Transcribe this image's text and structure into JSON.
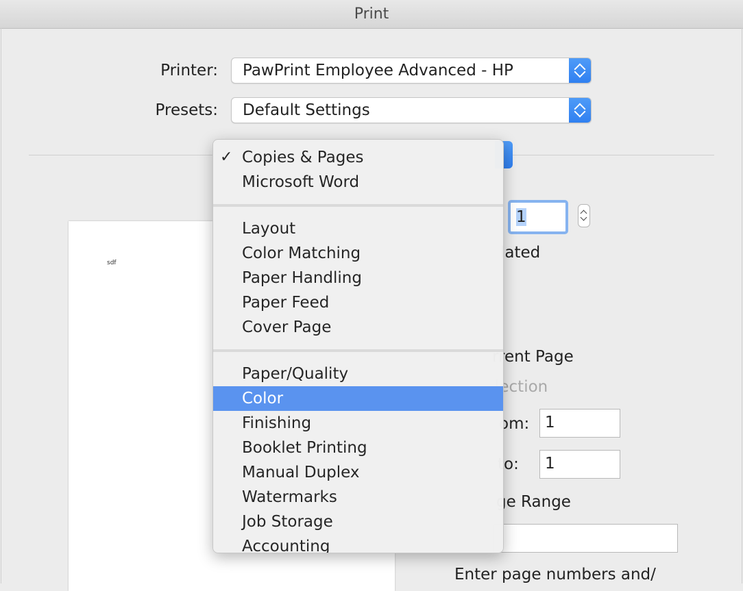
{
  "window": {
    "title": "Print"
  },
  "printer": {
    "label": "Printer:",
    "value": "PawPrint Employee Advanced - HP"
  },
  "presets": {
    "label": "Presets:",
    "value": "Default Settings"
  },
  "preview": {
    "page_text": "sdf"
  },
  "copies": {
    "value": "1",
    "collated_text": "lated"
  },
  "pages": {
    "current_page_text": "rrent Page",
    "selection_text": "lection",
    "from_label": "om:",
    "from_value": "1",
    "to_label": " to:",
    "to_value": "1",
    "page_range_text": "ge Range",
    "page_range_value": "",
    "hint_text": "Enter page numbers and/"
  },
  "menu": {
    "checkmark": "✓",
    "groups": [
      [
        "Copies & Pages",
        "Microsoft Word"
      ],
      [
        "Layout",
        "Color Matching",
        "Paper Handling",
        "Paper Feed",
        "Cover Page"
      ],
      [
        "Paper/Quality",
        "Color",
        "Finishing",
        "Booklet Printing",
        "Manual Duplex",
        "Watermarks",
        "Job Storage",
        "Accounting"
      ]
    ],
    "checked_item": "Copies & Pages",
    "highlighted_item": "Color"
  },
  "colors": {
    "accent": "#2f7ff0",
    "menu_highlight": "#5a93ef"
  },
  "icons": [
    "up-down-chevron-icon",
    "checkmark-icon"
  ]
}
